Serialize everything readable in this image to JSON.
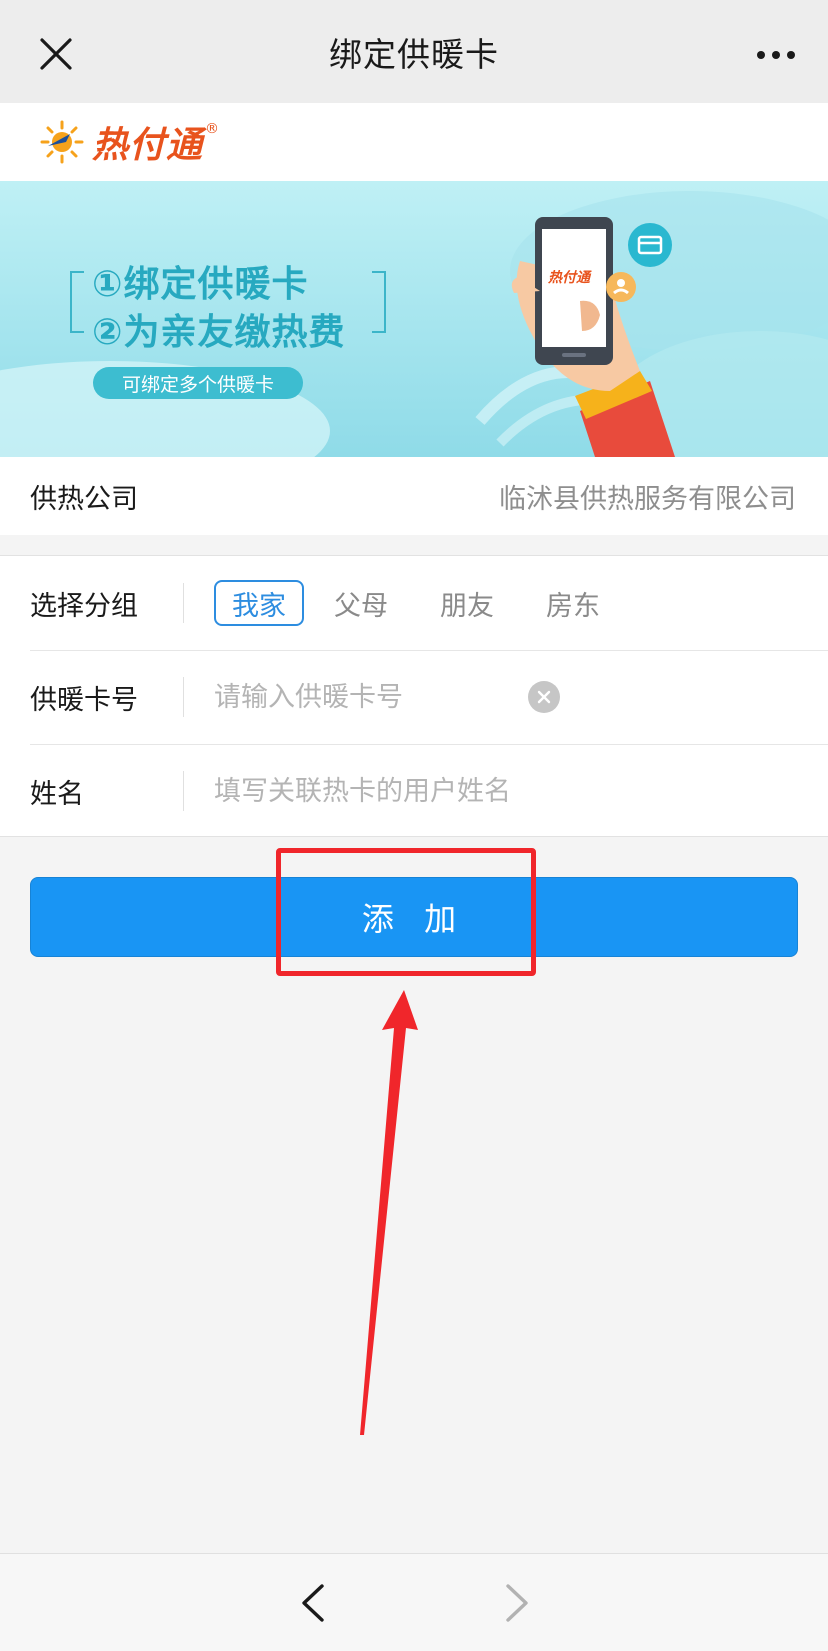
{
  "header": {
    "title": "绑定供暖卡",
    "close_icon": "close-icon",
    "more_icon": "more-dots-icon"
  },
  "brand": {
    "logo_text": "热付通",
    "registered_mark": "®",
    "accent_color": "#e8531d"
  },
  "banner": {
    "line1": "①绑定供暖卡",
    "line2": "②为亲友缴热费",
    "pill": "可绑定多个供暖卡",
    "phone_logo": "热付通"
  },
  "company": {
    "label": "供热公司",
    "value": "临沭县供热服务有限公司"
  },
  "form": {
    "group": {
      "label": "选择分组",
      "options": [
        "我家",
        "父母",
        "朋友",
        "房东"
      ],
      "selected": "我家"
    },
    "card_number": {
      "label": "供暖卡号",
      "value": "",
      "placeholder": "请输入供暖卡号"
    },
    "name": {
      "label": "姓名",
      "value": "",
      "placeholder": "填写关联热卡的用户姓名"
    }
  },
  "actions": {
    "add_label": "添 加",
    "primary_color": "#1995f4"
  },
  "annotation": {
    "highlight_color": "#f0262b"
  },
  "bottom_nav": {
    "back_icon": "chevron-left-icon",
    "forward_icon": "chevron-right-icon"
  }
}
